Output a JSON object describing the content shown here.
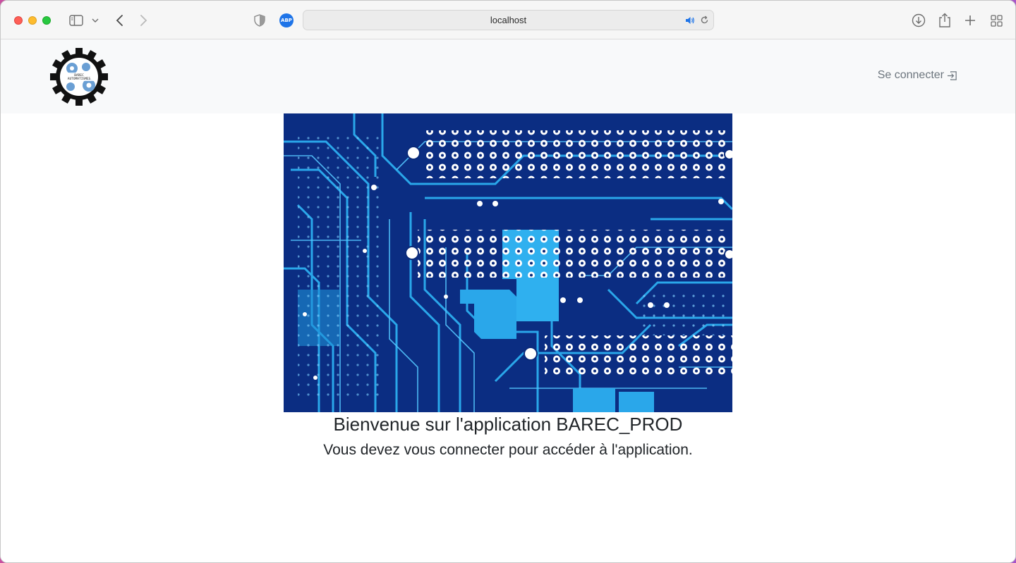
{
  "browser": {
    "url": "localhost",
    "abp_label": "ABP"
  },
  "navbar": {
    "logo_text": "BAREC AUTOMATISMES",
    "login_label": "Se connecter"
  },
  "main": {
    "welcome": "Bienvenue sur l'application BAREC_PROD",
    "subtitle": "Vous devez vous connecter pour accéder à l'application."
  },
  "colors": {
    "navbar_bg": "#f8f9fa",
    "text": "#212529",
    "link": "#6c757d",
    "circuit_dark": "#0a2a7a",
    "circuit_light": "#27a8e8"
  },
  "icons": [
    "sidebar-icon",
    "chevron-down-icon",
    "back-icon",
    "forward-icon",
    "shield-icon",
    "abp-icon",
    "sound-icon",
    "reload-icon",
    "download-icon",
    "share-icon",
    "plus-icon",
    "tabs-overview-icon",
    "login-icon",
    "gear-logo"
  ]
}
